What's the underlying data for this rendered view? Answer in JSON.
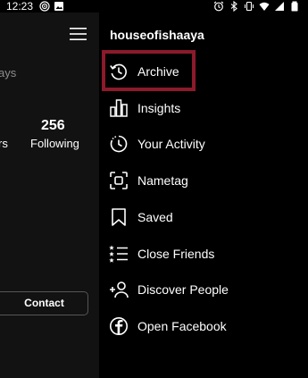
{
  "status_bar": {
    "time": "12:23",
    "left_icons": [
      "target-icon",
      "image-icon"
    ],
    "right_icons": [
      "alarm-icon",
      "bluetooth-icon",
      "vibrate-icon",
      "wifi-icon",
      "signal-icon",
      "battery-icon"
    ]
  },
  "profile": {
    "days_fragment": "ays",
    "followers_fragment": "rs",
    "following_count": "256",
    "following_label": "Following",
    "contact_label": "Contact"
  },
  "drawer": {
    "username": "houseofishaaya",
    "items": [
      {
        "label": "Archive",
        "icon": "archive-icon"
      },
      {
        "label": "Insights",
        "icon": "insights-icon"
      },
      {
        "label": "Your Activity",
        "icon": "activity-icon"
      },
      {
        "label": "Nametag",
        "icon": "nametag-icon"
      },
      {
        "label": "Saved",
        "icon": "bookmark-icon"
      },
      {
        "label": "Close Friends",
        "icon": "close-friends-icon"
      },
      {
        "label": "Discover People",
        "icon": "add-person-icon"
      },
      {
        "label": "Open Facebook",
        "icon": "facebook-icon"
      }
    ]
  },
  "highlight_color": "#8b1a2b"
}
